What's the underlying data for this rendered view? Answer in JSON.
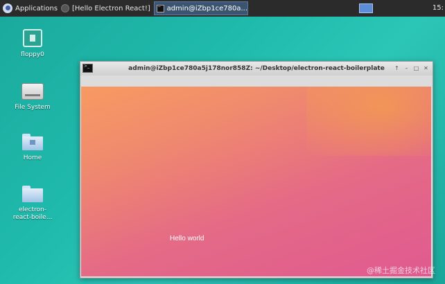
{
  "panel": {
    "apps_label": "Applications",
    "task1_label": "[Hello Electron React!]",
    "task2_label": "admin@iZbp1ce780a...",
    "clock": "15:"
  },
  "desktop": {
    "icons": [
      {
        "label": "floppy0"
      },
      {
        "label": "File System"
      },
      {
        "label": "Home"
      },
      {
        "label": "electron-\nreact-boile..."
      }
    ]
  },
  "window": {
    "title": "admin@iZbp1ce780a5j178nor858Z: ~/Desktop/electron-react-boilerplate",
    "buttons": [
      "↑",
      "–",
      "□",
      "✕"
    ],
    "content_text": "Hello world"
  },
  "watermark": "@稀土掘金技术社区"
}
